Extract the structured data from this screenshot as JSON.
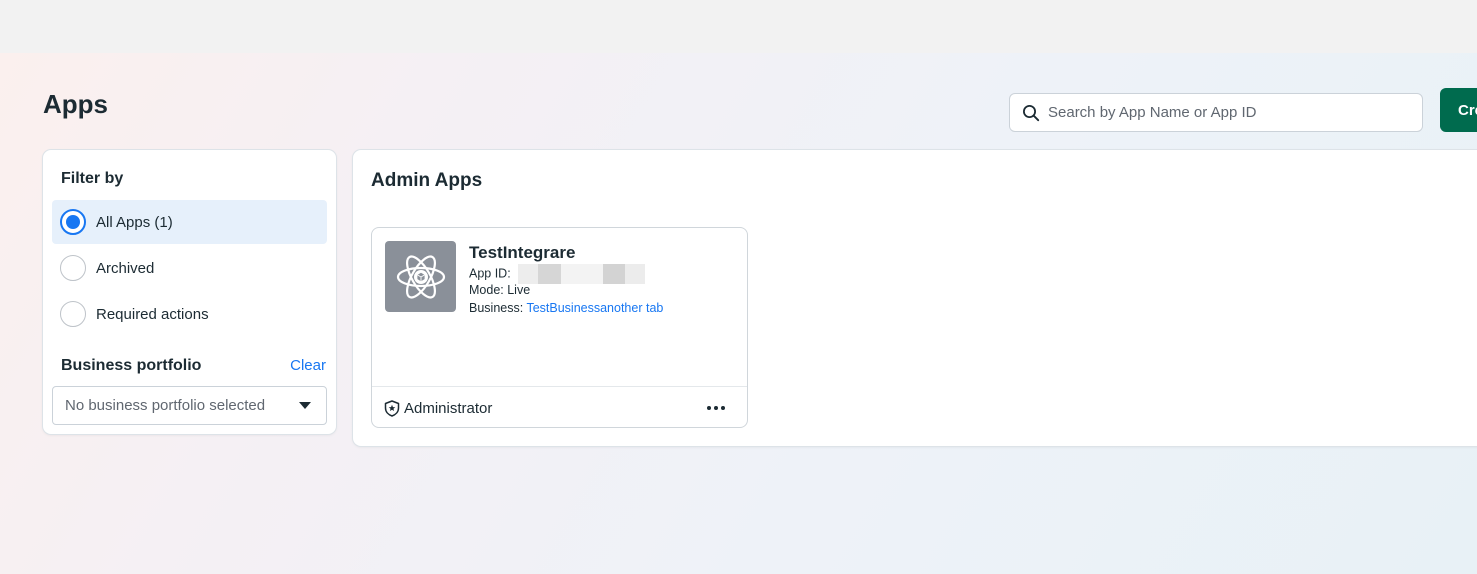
{
  "page": {
    "title": "Apps"
  },
  "search": {
    "placeholder": "Search by App Name or App ID"
  },
  "header": {
    "create_label": "Create App"
  },
  "filter": {
    "title": "Filter by",
    "options": [
      {
        "label": "All Apps (1)",
        "selected": true
      },
      {
        "label": "Archived",
        "selected": false
      },
      {
        "label": "Required actions",
        "selected": false
      }
    ],
    "portfolio_title": "Business portfolio",
    "clear_label": "Clear",
    "portfolio_value": "No business portfolio selected"
  },
  "apps_section": {
    "title": "Admin Apps",
    "apps": [
      {
        "name": "TestIntegrare",
        "app_id_label": "App ID:",
        "mode_text": "Mode: Live",
        "business_label": "Business:",
        "business_link": "TestBusinessanother tab",
        "role": "Administrator",
        "icon": "atom-app-icon",
        "role_icon": "shield-star-icon"
      }
    ]
  },
  "colors": {
    "accent": "#1877f2",
    "create_button": "#006b4e",
    "selected_row": "#e6f0fb"
  }
}
